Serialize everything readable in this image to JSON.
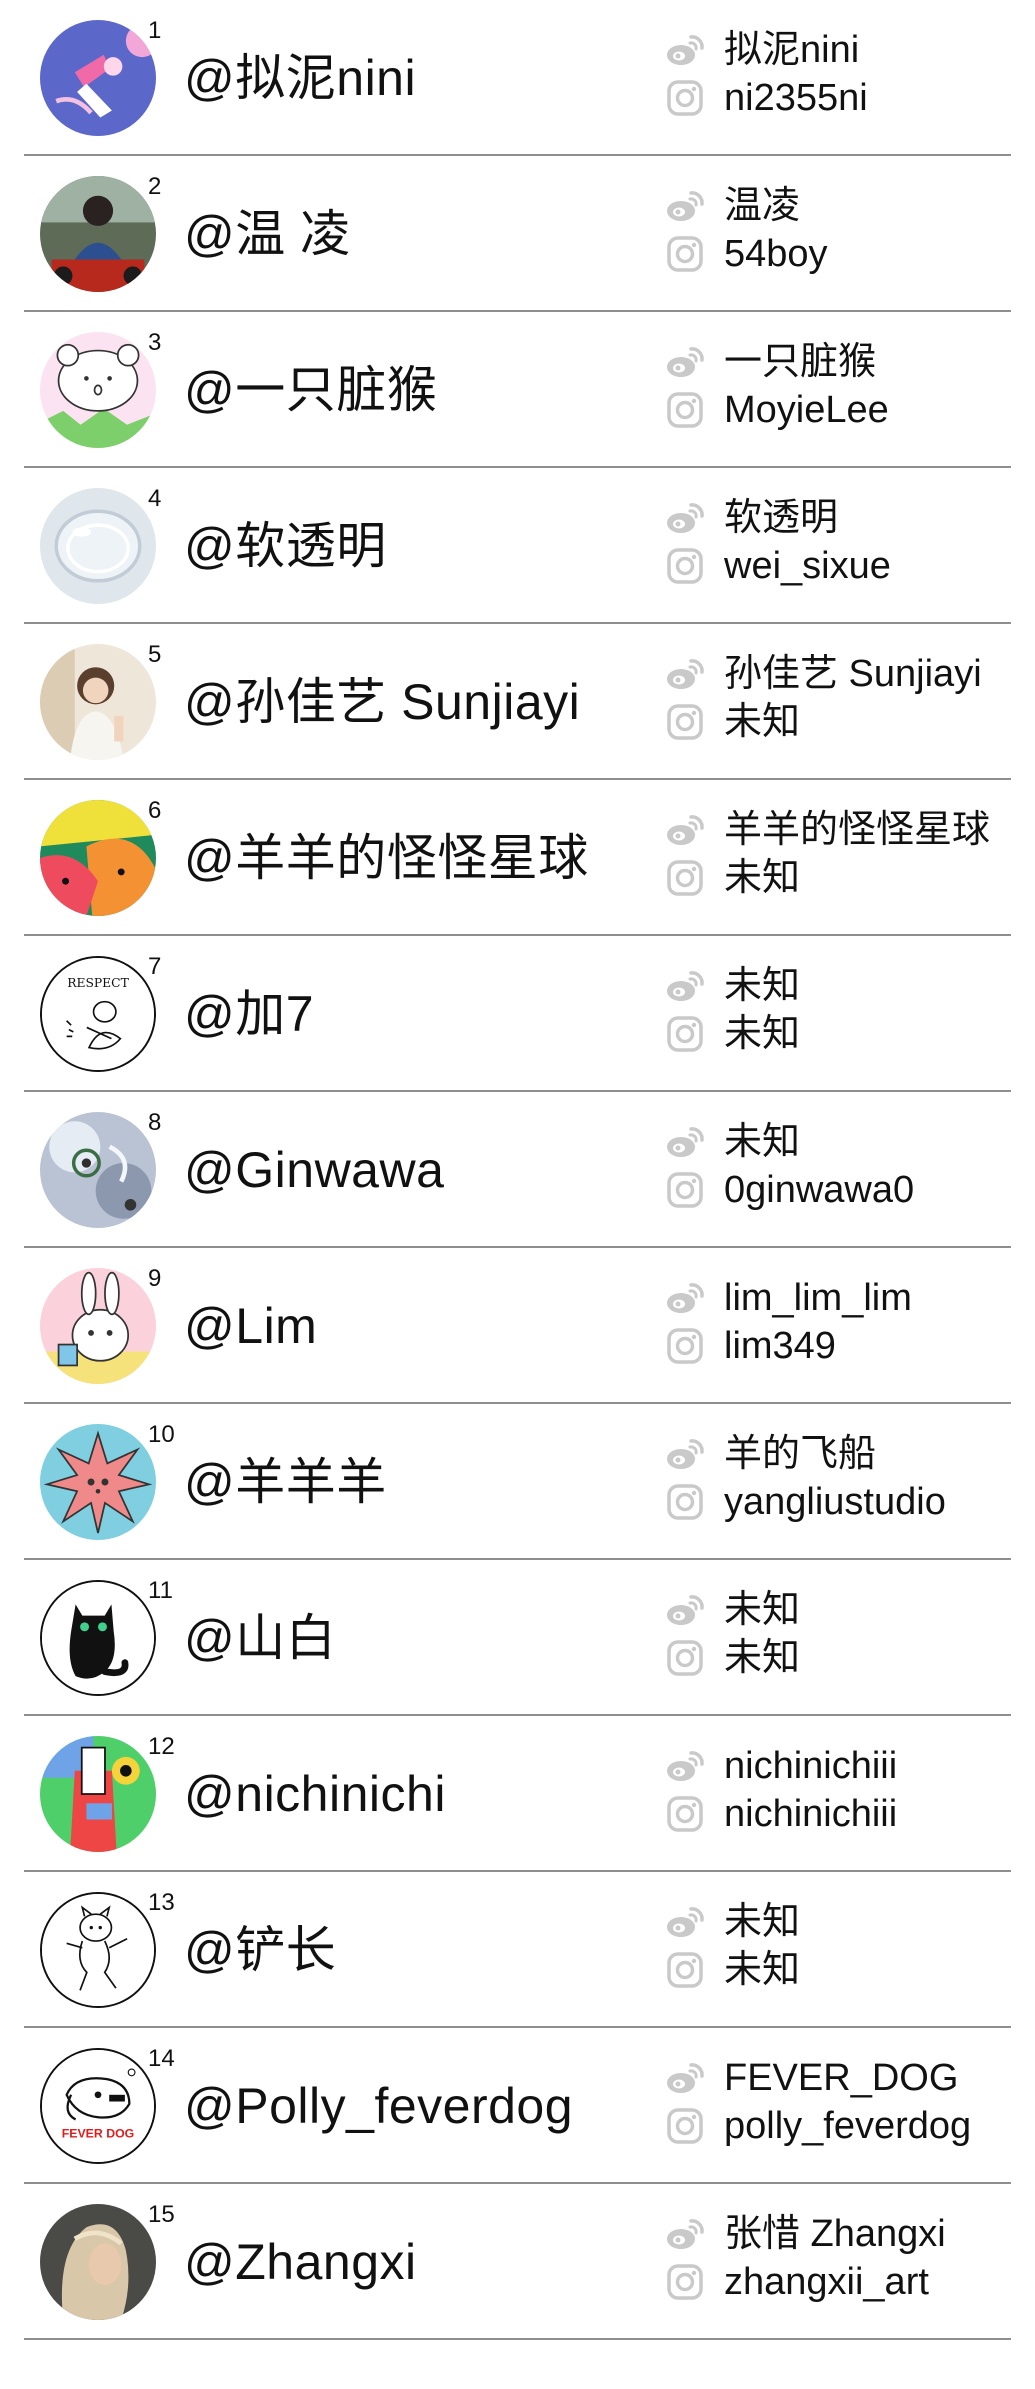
{
  "creators": [
    {
      "num": "1",
      "name": "@拟泥nini",
      "weibo": "拟泥nini",
      "instagram": "ni2355ni"
    },
    {
      "num": "2",
      "name": "@温 凌",
      "weibo": "温凌",
      "instagram": "54boy"
    },
    {
      "num": "3",
      "name": "@一只脏猴",
      "weibo": "一只脏猴",
      "instagram": "MoyieLee"
    },
    {
      "num": "4",
      "name": "@软透明",
      "weibo": "软透明",
      "instagram": "wei_sixue"
    },
    {
      "num": "5",
      "name": "@孙佳艺 Sunjiayi",
      "weibo": "孙佳艺 Sunjiayi",
      "instagram": "未知"
    },
    {
      "num": "6",
      "name": "@羊羊的怪怪星球",
      "weibo": "羊羊的怪怪星球",
      "instagram": "未知"
    },
    {
      "num": "7",
      "name": "@加7",
      "weibo": "未知",
      "instagram": "未知"
    },
    {
      "num": "8",
      "name": "@Ginwawa",
      "weibo": "未知",
      "instagram": "0ginwawa0"
    },
    {
      "num": "9",
      "name": "@Lim",
      "weibo": "lim_lim_lim",
      "instagram": "lim349"
    },
    {
      "num": "10",
      "name": "@羊羊羊",
      "weibo": "羊的飞船",
      "instagram": "yangliustudio"
    },
    {
      "num": "11",
      "name": "@山白",
      "weibo": "未知",
      "instagram": "未知"
    },
    {
      "num": "12",
      "name": "@nichinichi",
      "weibo": "nichinichiii",
      "instagram": "nichinichiii"
    },
    {
      "num": "13",
      "name": "@铲长",
      "weibo": "未知",
      "instagram": "未知"
    },
    {
      "num": "14",
      "name": "@Polly_feverdog",
      "weibo": "FEVER_DOG",
      "instagram": "polly_feverdog"
    },
    {
      "num": "15",
      "name": "@Zhangxi",
      "weibo": "张惜 Zhangxi",
      "instagram": "zhangxii_art"
    }
  ],
  "avatar_logo_text": {
    "respect": "RESPECT",
    "fever_dog": "FEVER DOG"
  }
}
